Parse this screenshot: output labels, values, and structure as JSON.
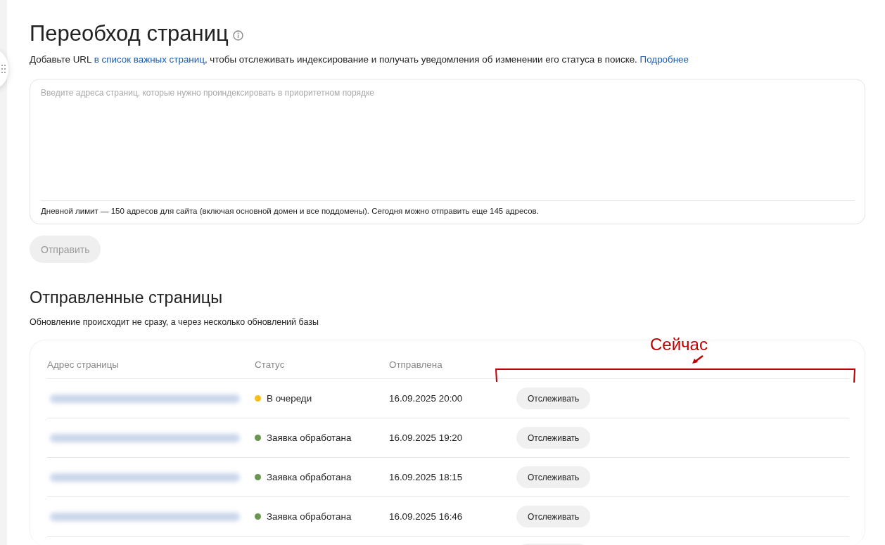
{
  "header": {
    "title": "Переобход страниц",
    "description_parts": [
      {
        "kind": "text",
        "text": "Добавьте URL "
      },
      {
        "kind": "link",
        "text": "в список важных страниц"
      },
      {
        "kind": "text",
        "text": ", чтобы отслеживать индексирование и получать уведомления об изменении его статуса в поиске. "
      },
      {
        "kind": "link",
        "text": "Подробнее"
      }
    ]
  },
  "url_input": {
    "placeholder": "Введите адреса страниц, которые нужно проиндексировать в приоритетном порядке",
    "limit_note": "Дневной лимит — 150 адресов для сайта (включая основной домен и все поддомены). Сегодня можно отправить еще 145 адресов."
  },
  "submit_button": {
    "label": "Отправить",
    "disabled": true
  },
  "sent_pages": {
    "title": "Отправленные страницы",
    "subtitle": "Обновление происходит не сразу, а через несколько обновлений базы",
    "columns": [
      "Адрес страницы",
      "Статус",
      "Отправлена"
    ],
    "rows": [
      {
        "status": "В очереди",
        "color": "#fcbc1a",
        "sent": "16.09.2025 20:00",
        "action": "Отслеживать"
      },
      {
        "status": "Заявка обработана",
        "color": "#6b9550",
        "sent": "16.09.2025 19:20",
        "action": "Отслеживать"
      },
      {
        "status": "Заявка обработана",
        "color": "#6b9550",
        "sent": "16.09.2025 18:15",
        "action": "Отслеживать"
      },
      {
        "status": "Заявка обработана",
        "color": "#6b9550",
        "sent": "16.09.2025 16:46",
        "action": "Отслеживать"
      }
    ]
  },
  "annotation": {
    "text": "Сейчас"
  }
}
